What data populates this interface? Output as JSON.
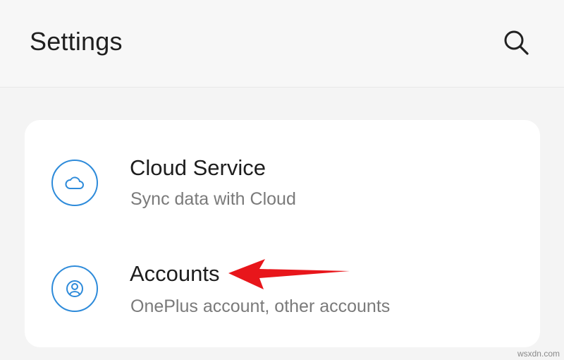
{
  "header": {
    "title": "Settings",
    "search_icon": "search-icon"
  },
  "settings_items": [
    {
      "title": "Cloud Service",
      "subtitle": "Sync data with Cloud",
      "icon": "cloud-icon"
    },
    {
      "title": "Accounts",
      "subtitle": "OnePlus account, other accounts",
      "icon": "account-icon"
    }
  ],
  "annotation": {
    "arrow_color": "#e8161b"
  },
  "theme": {
    "accent": "#2e8bda",
    "background": "#f4f4f4",
    "card": "#ffffff"
  },
  "watermark": "wsxdn.com"
}
